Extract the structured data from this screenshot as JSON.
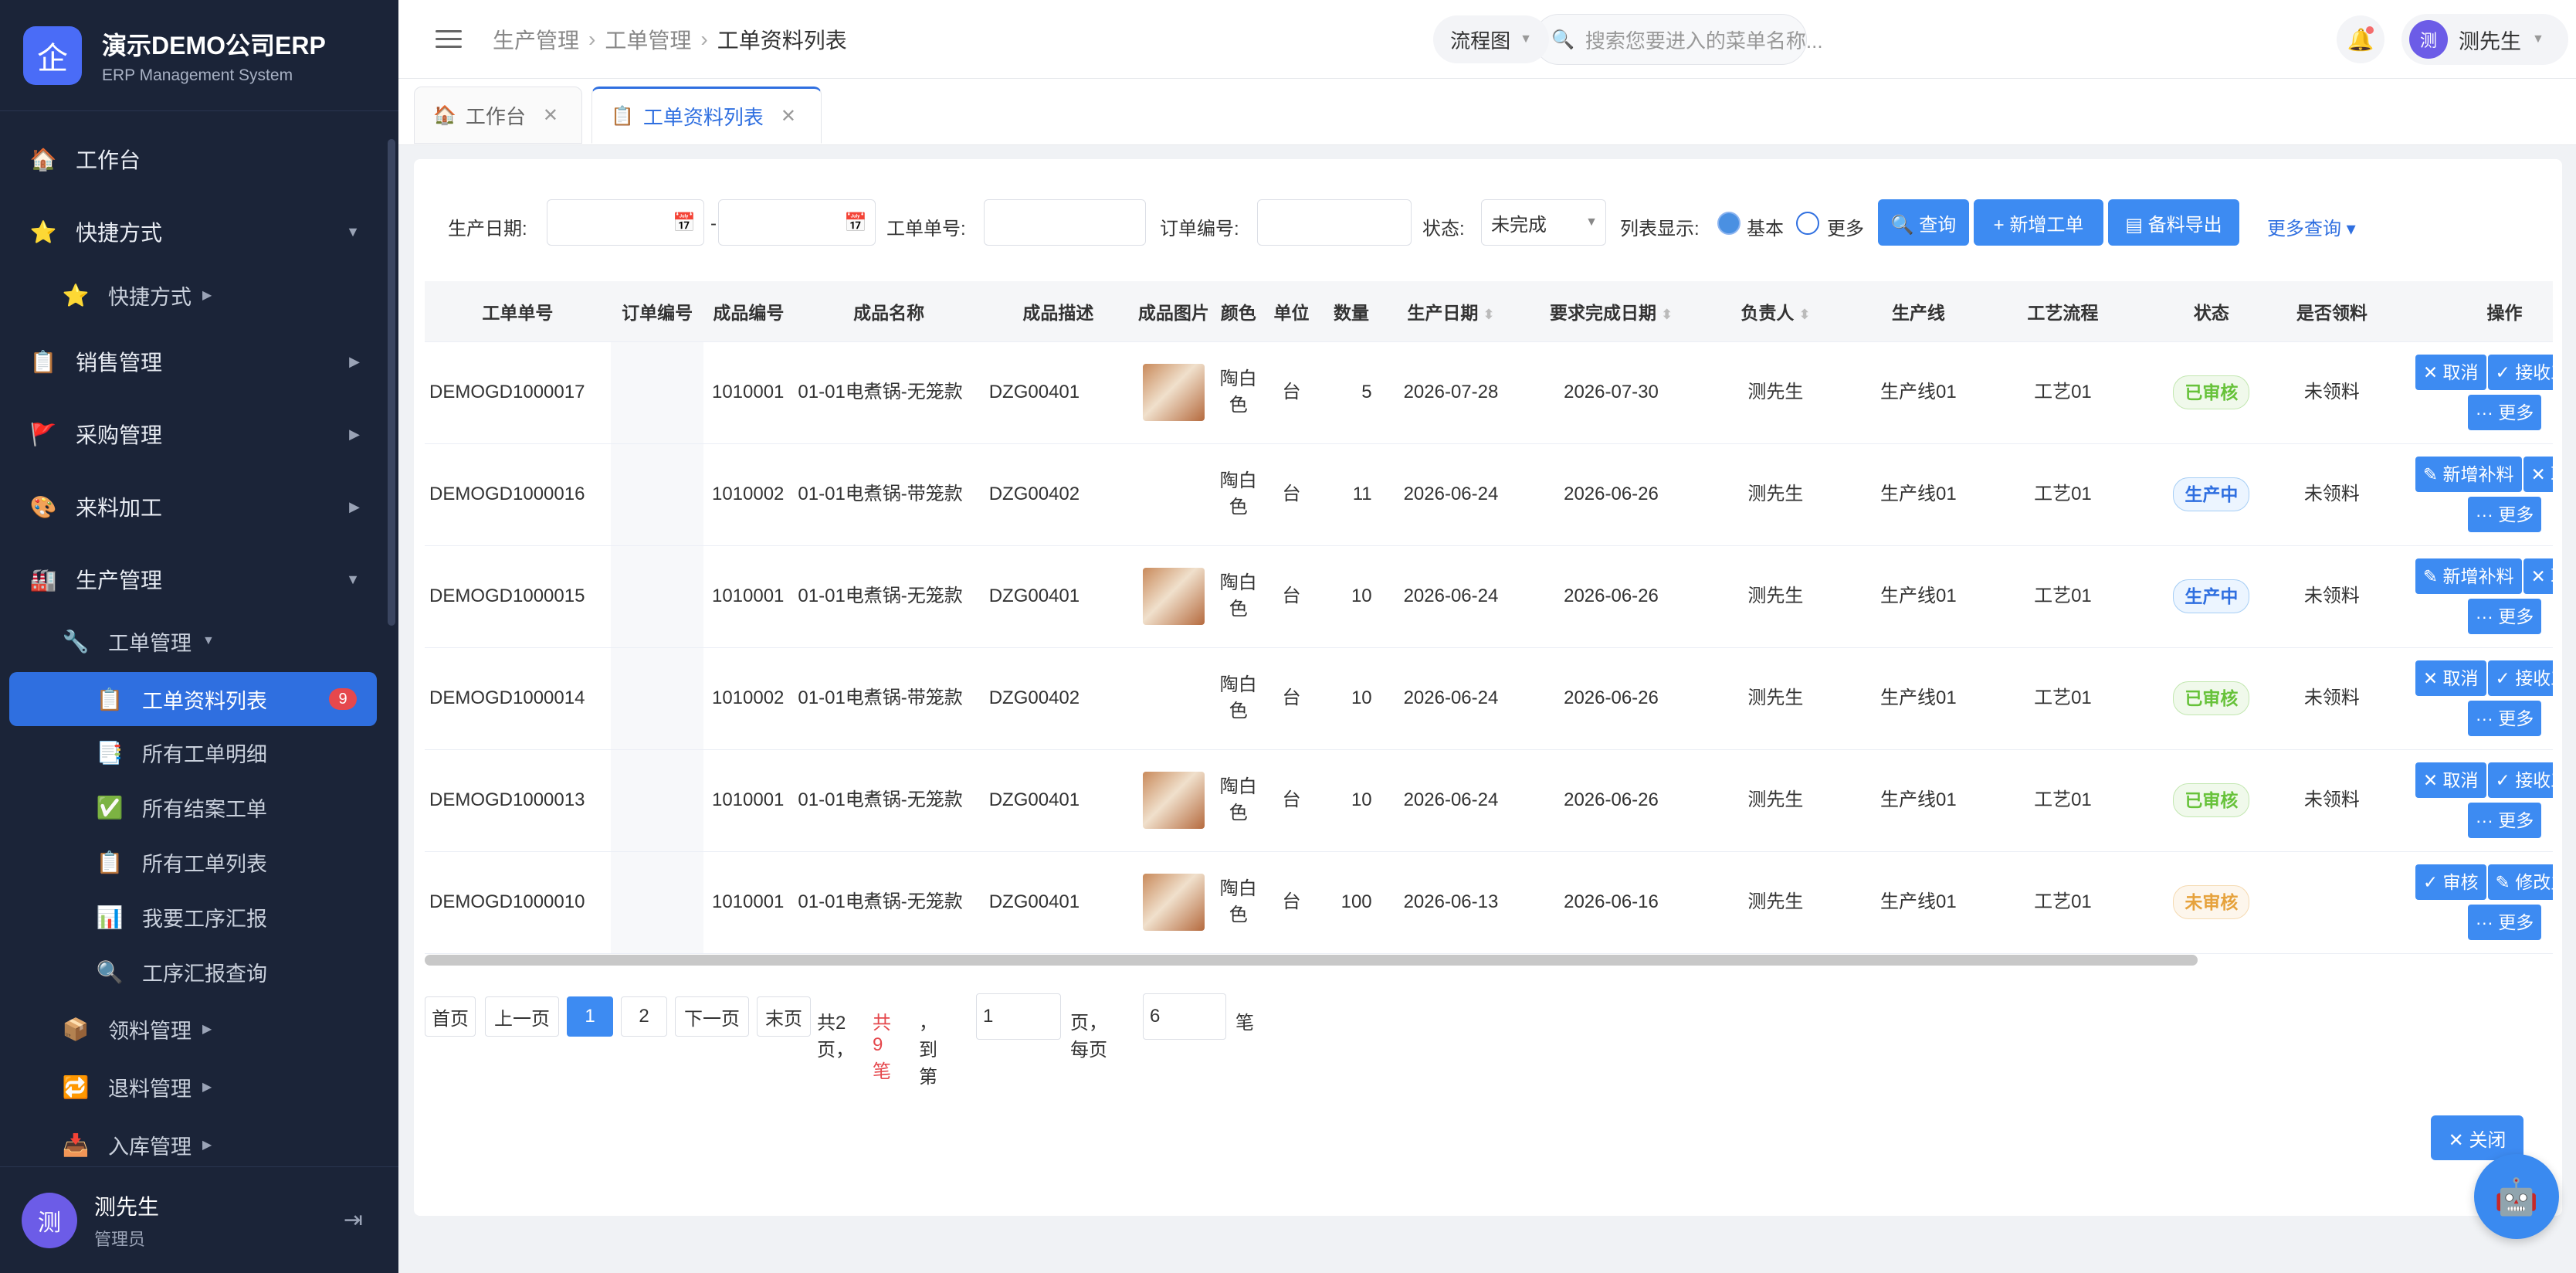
{
  "brand": {
    "logo": "企",
    "title": "演示DEMO公司ERP",
    "subtitle": "ERP Management System"
  },
  "sidebar": {
    "items": [
      {
        "label": "工作台",
        "icon": "🏠"
      },
      {
        "label": "快捷方式",
        "icon": "⭐",
        "arrow": "▼"
      },
      {
        "label": "快捷方式",
        "icon": "⭐",
        "arrow": "▶"
      },
      {
        "label": "销售管理",
        "icon": "📋",
        "arrow": "▶"
      },
      {
        "label": "采购管理",
        "icon": "🚩",
        "arrow": "▶"
      },
      {
        "label": "来料加工",
        "icon": "🎨",
        "arrow": "▶"
      },
      {
        "label": "生产管理",
        "icon": "🏭",
        "arrow": "▼"
      },
      {
        "label": "工单管理",
        "icon": "🔧",
        "arrow": "▼"
      },
      {
        "label": "工单资料列表",
        "icon": "📋",
        "badge": "9"
      },
      {
        "label": "所有工单明细",
        "icon": "📑"
      },
      {
        "label": "所有结案工单",
        "icon": "✅"
      },
      {
        "label": "所有工单列表",
        "icon": "📋"
      },
      {
        "label": "我要工序汇报",
        "icon": "📊"
      },
      {
        "label": "工序汇报查询",
        "icon": "🔍"
      },
      {
        "label": "领料管理",
        "icon": "📦",
        "arrow": "▶"
      },
      {
        "label": "退料管理",
        "icon": "🔁",
        "arrow": "▶"
      },
      {
        "label": "入库管理",
        "icon": "📥",
        "arrow": "▶"
      }
    ]
  },
  "user": {
    "avatar": "测",
    "name": "测先生",
    "role": "管理员",
    "logout_icon": "⇥"
  },
  "header": {
    "breadcrumb": [
      "生产管理",
      "工单管理",
      "工单资料列表"
    ],
    "search_placeholder": "搜索您要进入的菜单名称...",
    "flow_label": "流程图",
    "user_name": "测先生"
  },
  "tabs": [
    {
      "label": "工作台",
      "icon": "🏠",
      "close": "✕"
    },
    {
      "label": "工单资料列表",
      "icon": "📋",
      "close": "✕"
    }
  ],
  "filters": {
    "date_label": "生产日期:",
    "date_sep": "-",
    "wo_label": "工单单号:",
    "order_label": "订单编号:",
    "status_label": "状态:",
    "status_value": "未完成",
    "display_label": "列表显示:",
    "opt_basic": "基本",
    "opt_more": "更多",
    "btn_query": "🔍 查询",
    "btn_new": "+ 新增工单",
    "btn_export": "▤ 备料导出",
    "more_query": "更多查询 ▾"
  },
  "table": {
    "headers": [
      "工单单号",
      "订单编号",
      "成品编号",
      "成品名称",
      "成品描述",
      "成品图片",
      "颜色",
      "单位",
      "数量",
      "生产日期",
      "要求完成日期",
      "负责人",
      "生产线",
      "工艺流程",
      "状态",
      "是否领料",
      "操作"
    ],
    "rows": [
      {
        "wo": "DEMOGD1000017",
        "order": "",
        "code": "1010001",
        "name": "01-01电煮锅-无笼款",
        "desc": "DZG00401",
        "img": true,
        "color": "陶白色",
        "unit": "台",
        "qty": "5",
        "pdate": "2026-07-28",
        "ddate": "2026-07-30",
        "owner": "测先生",
        "line": "生产线01",
        "flow": "工艺01",
        "status": "已审核",
        "status_type": "approved",
        "picked": "未领料",
        "ops": [
          "✕ 取消",
          "✓ 接收工单",
          "··· 更多"
        ]
      },
      {
        "wo": "DEMOGD1000016",
        "order": "",
        "code": "1010002",
        "name": "01-01电煮锅-带笼款",
        "desc": "DZG00402",
        "img": false,
        "color": "陶白色",
        "unit": "台",
        "qty": "11",
        "pdate": "2026-06-24",
        "ddate": "2026-06-26",
        "owner": "测先生",
        "line": "生产线01",
        "flow": "工艺01",
        "status": "生产中",
        "status_type": "producing",
        "picked": "未领料",
        "ops": [
          "✎ 新增补料",
          "✕ 取消",
          "··· 更多"
        ]
      },
      {
        "wo": "DEMOGD1000015",
        "order": "",
        "code": "1010001",
        "name": "01-01电煮锅-无笼款",
        "desc": "DZG00401",
        "img": true,
        "color": "陶白色",
        "unit": "台",
        "qty": "10",
        "pdate": "2026-06-24",
        "ddate": "2026-06-26",
        "owner": "测先生",
        "line": "生产线01",
        "flow": "工艺01",
        "status": "生产中",
        "status_type": "producing",
        "picked": "未领料",
        "ops": [
          "✎ 新增补料",
          "✕ 取消",
          "··· 更多"
        ]
      },
      {
        "wo": "DEMOGD1000014",
        "order": "",
        "code": "1010002",
        "name": "01-01电煮锅-带笼款",
        "desc": "DZG00402",
        "img": false,
        "color": "陶白色",
        "unit": "台",
        "qty": "10",
        "pdate": "2026-06-24",
        "ddate": "2026-06-26",
        "owner": "测先生",
        "line": "生产线01",
        "flow": "工艺01",
        "status": "已审核",
        "status_type": "approved",
        "picked": "未领料",
        "ops": [
          "✕ 取消",
          "✓ 接收工单",
          "··· 更多"
        ]
      },
      {
        "wo": "DEMOGD1000013",
        "order": "",
        "code": "1010001",
        "name": "01-01电煮锅-无笼款",
        "desc": "DZG00401",
        "img": true,
        "color": "陶白色",
        "unit": "台",
        "qty": "10",
        "pdate": "2026-06-24",
        "ddate": "2026-06-26",
        "owner": "测先生",
        "line": "生产线01",
        "flow": "工艺01",
        "status": "已审核",
        "status_type": "approved",
        "picked": "未领料",
        "ops": [
          "✕ 取消",
          "✓ 接收工单",
          "··· 更多"
        ]
      },
      {
        "wo": "DEMOGD1000010",
        "order": "",
        "code": "1010001",
        "name": "01-01电煮锅-无笼款",
        "desc": "DZG00401",
        "img": true,
        "color": "陶白色",
        "unit": "台",
        "qty": "100",
        "pdate": "2026-06-13",
        "ddate": "2026-06-16",
        "owner": "测先生",
        "line": "生产线01",
        "flow": "工艺01",
        "status": "未审核",
        "status_type": "unapproved",
        "picked": "",
        "ops": [
          "✓ 审核",
          "✎ 修改主档",
          "··· 更多"
        ]
      }
    ]
  },
  "pager": {
    "first": "首页",
    "prev": "上一页",
    "p1": "1",
    "p2": "2",
    "next": "下一页",
    "last": "末页",
    "total_pages": "共2页，",
    "total_records": "共9笔",
    "goto_label": "，到第",
    "goto_value": "1",
    "per_label": "页，每页",
    "per_value": "6",
    "unit": "笔"
  },
  "close_label": "✕ 关闭",
  "colors": {
    "sidebar_bg": "#1b2438",
    "accent": "#2f6fe0",
    "button": "#3d8bf2"
  }
}
